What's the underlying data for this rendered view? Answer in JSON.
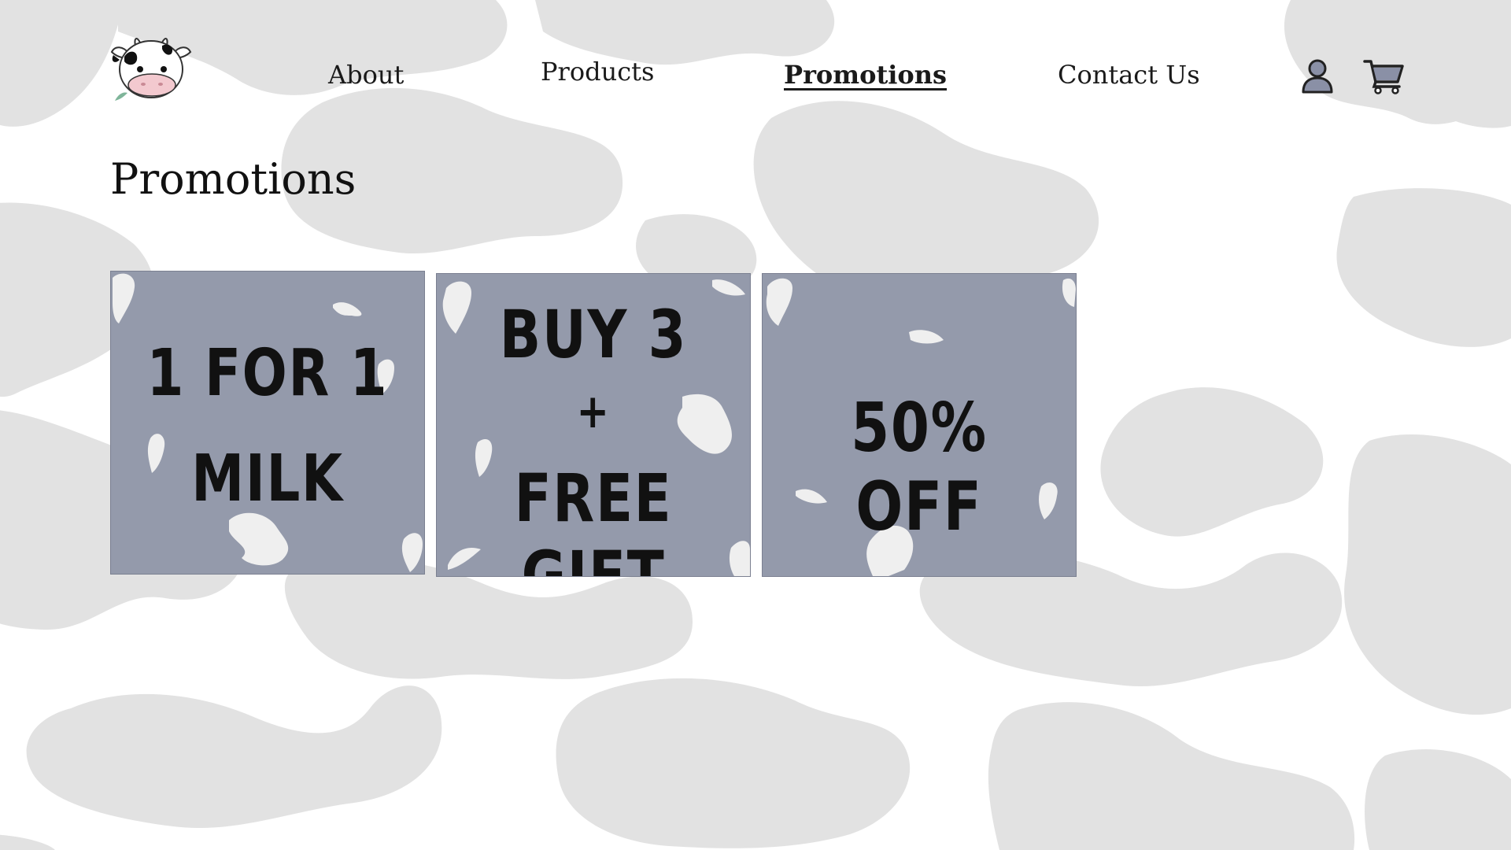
{
  "nav": {
    "items": [
      {
        "label": "About"
      },
      {
        "label": "Products"
      },
      {
        "label": "Promotions",
        "active": true
      },
      {
        "label": "Contact Us"
      }
    ],
    "icons": {
      "account": "user-icon",
      "cart": "shopping-cart-icon"
    }
  },
  "logo": {
    "icon": "cow-head-logo"
  },
  "page": {
    "title": "Promotions"
  },
  "promotions": [
    {
      "lines": [
        "1 FOR 1",
        "MILK"
      ]
    },
    {
      "lines": [
        "BUY 3",
        "+",
        "FREE GIFT"
      ]
    },
    {
      "lines": [
        "50% OFF"
      ]
    }
  ],
  "colors": {
    "background": "#ffffff",
    "cow_spots": "#e2e2e2",
    "card": "#949aab",
    "icon_fill": "#8a90a6",
    "text": "#111111"
  }
}
